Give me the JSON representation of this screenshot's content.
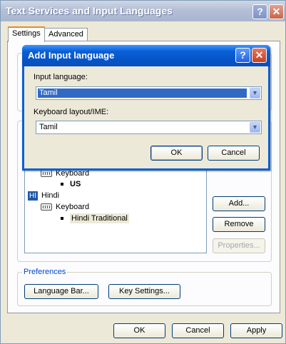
{
  "window": {
    "title": "Text Services and Input Languages",
    "help_glyph": "?",
    "close_glyph": "✕"
  },
  "tabs": [
    {
      "label": "Settings",
      "active": true
    },
    {
      "label": "Advanced",
      "active": false
    }
  ],
  "installed": {
    "items": [
      {
        "type": "category",
        "label": "Keyboard"
      },
      {
        "type": "layout",
        "label": "US",
        "bold": true
      },
      {
        "type": "language",
        "badge": "HI",
        "label": "Hindi"
      },
      {
        "type": "category",
        "label": "Keyboard"
      },
      {
        "type": "layout",
        "label": "Hindi Traditional",
        "selected": true
      }
    ],
    "buttons": {
      "add": "Add...",
      "remove": "Remove",
      "properties": "Properties..."
    }
  },
  "preferences": {
    "legend": "Preferences",
    "language_bar": "Language Bar...",
    "key_settings": "Key Settings..."
  },
  "footer": {
    "ok": "OK",
    "cancel": "Cancel",
    "apply": "Apply"
  },
  "dialog": {
    "title": "Add Input language",
    "help_glyph": "?",
    "close_glyph": "✕",
    "input_language_label": "Input language:",
    "input_language_value": "Tamil",
    "keyboard_layout_label": "Keyboard layout/IME:",
    "keyboard_layout_value": "Tamil",
    "ok": "OK",
    "cancel": "Cancel",
    "dropdown_glyph": "▼"
  },
  "colors": {
    "dialog_title": "#0a5fd6",
    "selection": "#316ac5",
    "group_label": "#0046d5"
  }
}
